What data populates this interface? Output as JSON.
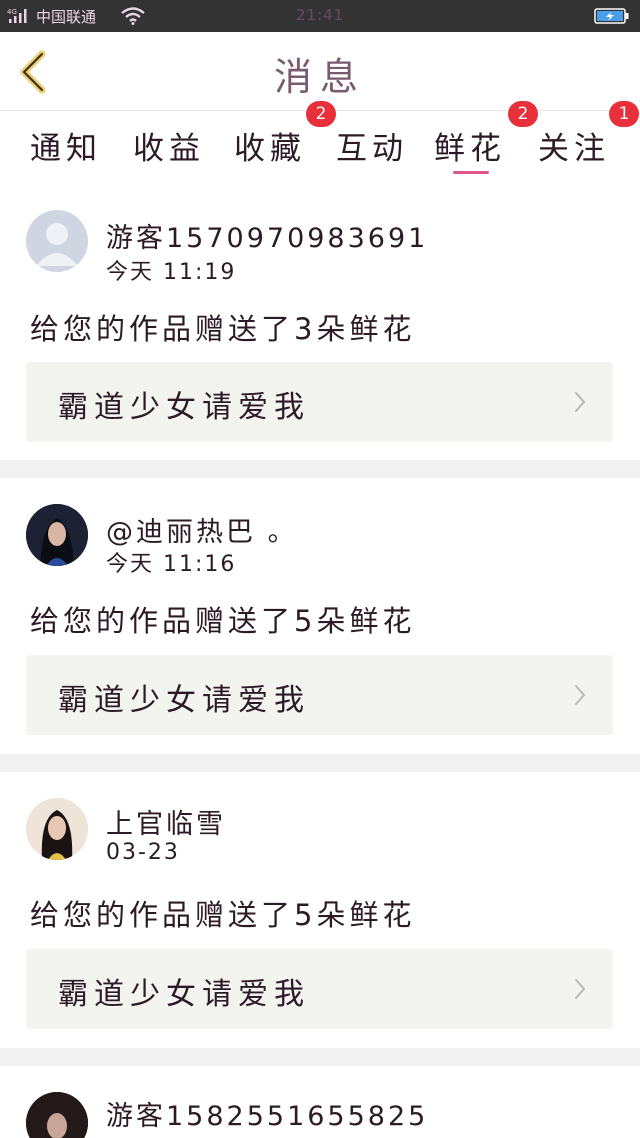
{
  "status_bar": {
    "network": "4G",
    "carrier": "中国联通",
    "time": "21:41"
  },
  "nav": {
    "title": "消息"
  },
  "tabs": [
    {
      "label": "通知",
      "badge": ""
    },
    {
      "label": "收益",
      "badge": ""
    },
    {
      "label": "收藏",
      "badge": "2"
    },
    {
      "label": "互动",
      "badge": ""
    },
    {
      "label": "鲜花",
      "badge": "2",
      "active": true
    },
    {
      "label": "关注",
      "badge": "1"
    }
  ],
  "messages": [
    {
      "username": "游客1570970983691",
      "time": "今天 11:19",
      "text": "给您的作品赠送了3朵鲜花",
      "work_title": "霸道少女请爱我"
    },
    {
      "username": "@迪丽热巴 。",
      "time": "今天 11:16",
      "text": "给您的作品赠送了5朵鲜花",
      "work_title": "霸道少女请爱我"
    },
    {
      "username": "上官临雪",
      "time": "03-23",
      "text": "给您的作品赠送了5朵鲜花",
      "work_title": "霸道少女请爱我"
    },
    {
      "username": "游客1582551655825",
      "time": "",
      "text": "",
      "work_title": ""
    }
  ],
  "colors": {
    "accent": "#e0568a",
    "badge": "#e8303a",
    "status_bar": "#333333",
    "work_box": "#f3f3ef"
  }
}
